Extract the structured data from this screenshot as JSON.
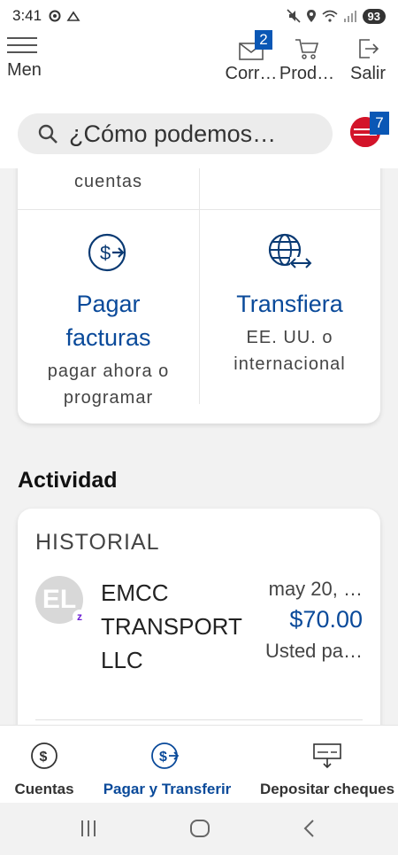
{
  "status_bar": {
    "time": "3:41",
    "battery": "93"
  },
  "header": {
    "menu_label": "Men",
    "mail": {
      "label": "Corr…",
      "badge": "2"
    },
    "products": {
      "label": "Prod…"
    },
    "logout": {
      "label": "Salir"
    }
  },
  "search": {
    "placeholder": "¿Cómo podemos…",
    "notifications_badge": "7"
  },
  "quick_actions": {
    "previous_tail": "cuentas",
    "pay_bills": {
      "title_line1": "Pagar",
      "title_line2": "facturas",
      "sub_line1": "pagar ahora o",
      "sub_line2": "programar"
    },
    "transfer": {
      "title": "Transfiera",
      "sub_line1": "EE. UU. o",
      "sub_line2": "internacional"
    }
  },
  "activity": {
    "heading": "Actividad",
    "section_label": "HISTORIAL",
    "transactions": [
      {
        "avatar_initials": "EL",
        "payee_line1": "EMCC",
        "payee_line2": "TRANSPORT",
        "payee_line3": "LLC",
        "date": "may 20, …",
        "amount": "$70.00",
        "description": "Usted pa…"
      }
    ]
  },
  "bottom_nav": {
    "accounts": "Cuentas",
    "pay_transfer": "Pagar y Transferir",
    "deposit": "Depositar cheques"
  },
  "colors": {
    "brand_blue": "#0a4a9a",
    "badge_blue": "#0a57b5",
    "logo_red": "#d3142a"
  }
}
